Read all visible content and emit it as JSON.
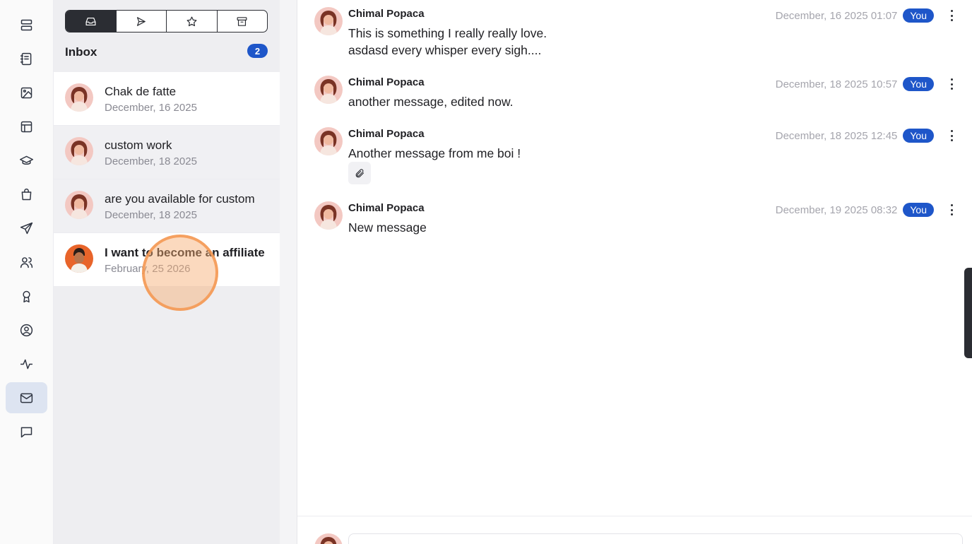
{
  "rail": {
    "items": [
      {
        "icon": "dashboard-icon"
      },
      {
        "icon": "notebook-icon"
      },
      {
        "icon": "image-icon"
      },
      {
        "icon": "layout-icon"
      },
      {
        "icon": "graduation-cap-icon"
      },
      {
        "icon": "shopping-bag-icon"
      },
      {
        "icon": "send-icon"
      },
      {
        "icon": "users-icon"
      },
      {
        "icon": "award-icon"
      },
      {
        "icon": "user-circle-icon"
      },
      {
        "icon": "activity-icon"
      },
      {
        "icon": "mail-icon",
        "active": true
      },
      {
        "icon": "chat-bubble-icon"
      }
    ]
  },
  "tabs": [
    {
      "icon": "inbox-icon",
      "active": true
    },
    {
      "icon": "sent-icon"
    },
    {
      "icon": "star-icon"
    },
    {
      "icon": "archive-icon"
    }
  ],
  "inbox": {
    "title": "Inbox",
    "count": "2"
  },
  "conversations": [
    {
      "title": "Chak de fatte",
      "date": "December, 16 2025",
      "avatar": "woman"
    },
    {
      "title": "custom work",
      "date": "December, 18 2025",
      "avatar": "woman"
    },
    {
      "title": "are you available for custom",
      "date": "December, 18 2025",
      "avatar": "woman"
    },
    {
      "title": "I want to become an affiliate",
      "date": "February, 25 2026",
      "avatar": "man",
      "unread": true
    }
  ],
  "messages": [
    {
      "sender": "Chimal Popaca",
      "lines": [
        "This is something I really really love.",
        "asdasd every whisper every sigh...."
      ],
      "timestamp": "December, 16 2025 01:07",
      "badge": "You"
    },
    {
      "sender": "Chimal Popaca",
      "lines": [
        "another message, edited now."
      ],
      "timestamp": "December, 18 2025 10:57",
      "badge": "You"
    },
    {
      "sender": "Chimal Popaca",
      "lines": [
        "Another message from me boi !"
      ],
      "timestamp": "December, 18 2025 12:45",
      "badge": "You",
      "attachment": "paperclip-icon"
    },
    {
      "sender": "Chimal Popaca",
      "lines": [
        "New message"
      ],
      "timestamp": "December, 19 2025 08:32",
      "badge": "You"
    }
  ],
  "colors": {
    "accent": "#1e56c9",
    "active_rail": "#dde4f1",
    "cursor": "#f5a565"
  }
}
